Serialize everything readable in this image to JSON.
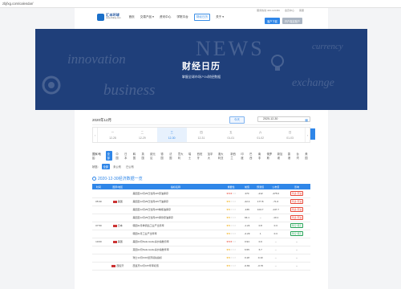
{
  "url": "zbjfxg.com/calendar/",
  "topinfo": {
    "phone": "服务热线 400-123456",
    "links": "会员中心",
    "service": "客服"
  },
  "logo": {
    "name": "汇丰环球",
    "sub": "www.zbjfxg.com"
  },
  "nav": [
    {
      "label": "首页",
      "active": false
    },
    {
      "label": "交易产品",
      "active": false
    },
    {
      "label": "资讯中心",
      "active": false
    },
    {
      "label": "学院平台",
      "active": false
    },
    {
      "label": "财经日历",
      "active": true
    },
    {
      "label": "关于",
      "active": false
    }
  ],
  "buttons": {
    "download": "客户下载",
    "account": "开户真实账户"
  },
  "banner": {
    "title": "财经日历",
    "subtitle": "掌握全球市场7*24财经数据",
    "bg_words": [
      "innovation",
      "NEWS",
      "currency",
      "business",
      "exchange"
    ]
  },
  "datebar": {
    "month": "2020年12月",
    "today": "今天",
    "date": "2020-12-30"
  },
  "week": [
    {
      "wd": "一",
      "date": "12-28",
      "active": false
    },
    {
      "wd": "二",
      "date": "12-29",
      "active": false
    },
    {
      "wd": "三",
      "date": "12-30",
      "active": true
    },
    {
      "wd": "四",
      "date": "12-31",
      "active": false
    },
    {
      "wd": "五",
      "date": "01-01",
      "active": false
    },
    {
      "wd": "六",
      "date": "01-02",
      "active": false
    },
    {
      "wd": "日",
      "date": "01-03",
      "active": false
    }
  ],
  "filters": {
    "region_label": "国家/地区:",
    "regions": [
      "全部",
      "中国",
      "日本",
      "韩国",
      "英国",
      "欧元区",
      "德国",
      "法国",
      "意大利",
      "瑞士",
      "西班牙",
      "加拿大",
      "澳大利亚",
      "新西兰",
      "印度",
      "巴西",
      "南非",
      "俄罗斯",
      "新加坡",
      "香港",
      "台湾",
      "美国"
    ],
    "state_label": "状态:",
    "states": [
      "全部",
      "未公布",
      "已公布"
    ]
  },
  "section_title": "2020-12-30经济数据一览",
  "table": {
    "headers": [
      "时间",
      "国家/地区",
      "指标名称",
      "重要性",
      "前值",
      "预测值",
      "公布值",
      "影响"
    ],
    "rows": [
      {
        "time": "",
        "country": "",
        "event": "美国至12月25日当周API原油库存",
        "stars": 3,
        "red": true,
        "prev": "270",
        "fore": "-212",
        "act": "-475.6",
        "impact": "利多 原油"
      },
      {
        "time": "05:30",
        "country": "美国",
        "event": "美国至12月25日当周API汽油库存",
        "stars": 2,
        "red": false,
        "prev": "-22.4",
        "fore": "177.8",
        "act": "-71.6",
        "impact": "利多 原油"
      },
      {
        "time": "",
        "country": "",
        "event": "美国至12月25日当周API精炼油库存",
        "stars": 2,
        "red": false,
        "prev": "-165",
        "fore": "104.7",
        "act": "-147.7",
        "impact": "利多 原油"
      },
      {
        "time": "",
        "country": "",
        "event": "美国至12月25日当周API库欣原油库存",
        "stars": 2,
        "red": false,
        "prev": "94.1",
        "fore": "--",
        "act": "-10.1",
        "impact": "利多 原油"
      },
      {
        "time": "07:50",
        "country": "日本",
        "event": "韩国11月季调后工业产出月率",
        "stars": 2,
        "red": false,
        "prev": "-1.24",
        "fore": "0.8",
        "act": "0.3",
        "impact": "利空 韩元"
      },
      {
        "time": "",
        "country": "",
        "event": "韩国11月工业产出年率",
        "stars": 2,
        "red": false,
        "prev": "-2.29",
        "fore": "1",
        "act": "0.3",
        "impact": "利空 韩元"
      },
      {
        "time": "10:00",
        "country": "美国",
        "event": "美国12月Nationwide房价指数月率",
        "stars": 3,
        "red": true,
        "prev": "0.94",
        "fore": "0.0",
        "act": "--",
        "impact": "--"
      },
      {
        "time": "",
        "country": "",
        "event": "英国12月Nationwide房价指数年率",
        "stars": 2,
        "red": false,
        "prev": "6.55",
        "fore": "6.7",
        "act": "--",
        "impact": "--"
      },
      {
        "time": "",
        "country": "",
        "event": "瑞士12月KOF经济领先指标",
        "stars": 2,
        "red": false,
        "prev": "0.18",
        "fore": "0.10",
        "act": "--",
        "impact": "--"
      },
      {
        "time": "",
        "country": "西班牙",
        "event": "西班牙12月CPI年率初值",
        "stars": 2,
        "red": false,
        "prev": "-0.84",
        "fore": "-0.70",
        "act": "--",
        "impact": "--"
      }
    ]
  }
}
